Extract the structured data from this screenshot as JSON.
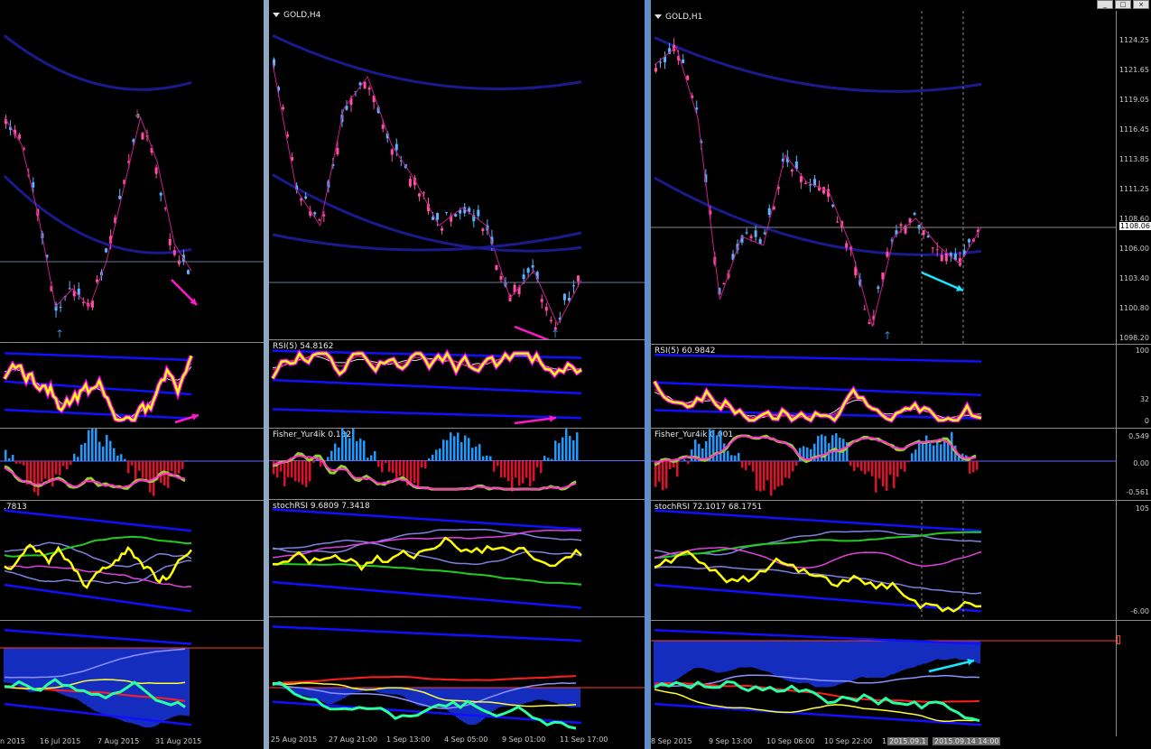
{
  "windows": [
    {
      "id": "left",
      "title": "",
      "rsi_label": "",
      "fisher_label": "",
      "stoch_label": ".7813",
      "x_labels": [
        "n 2015",
        "16 Jul 2015",
        "7 Aug 2015",
        "31 Aug 2015"
      ]
    },
    {
      "id": "middle",
      "title": "GOLD,H4",
      "rsi_label": "RSI(5) 54.8162",
      "fisher_label": "Fisher_Yur4ik 0.132",
      "stoch_label": "stochRSI 9.6809 7.3418",
      "x_labels": [
        "25 Aug 2015",
        "27 Aug 21:00",
        "1 Sep 13:00",
        "4 Sep 05:00",
        "9 Sep 01:00",
        "11 Sep 17:00"
      ]
    },
    {
      "id": "right",
      "title": "GOLD,H1",
      "rsi_label": "RSI(5) 60.9842",
      "fisher_label": "Fisher_Yur4ik 0.001",
      "stoch_label": "stochRSI 72.1017 68.1751",
      "x_labels": [
        "8 Sep 2015",
        "9 Sep 13:00",
        "10 Sep 06:00",
        "10 Sep 22:00",
        "1",
        "2015.09.1",
        "2015.09.14 14:00"
      ],
      "price_levels": [
        "1124.25",
        "1121.65",
        "1119.05",
        "1116.45",
        "1113.85",
        "1111.25",
        "1108.60",
        "1106.00",
        "1103.40",
        "1100.80",
        "1098.20"
      ],
      "current_price": "1108.06",
      "rsi_levels": [
        "100",
        "32",
        "0"
      ],
      "fisher_levels": [
        "0.549",
        "0.00",
        "-0.561"
      ],
      "stoch_levels": [
        "105",
        "-6.00"
      ]
    }
  ],
  "window_controls": {
    "minimize": "_",
    "restore": "□",
    "close": "×"
  },
  "colors": {
    "bull_candle": "#5ab4ff",
    "bear_candle": "#ff4fa3",
    "ma_band": "#1a1a8c",
    "rsi_main": "#ffff00",
    "rsi_shadow": "#ff00ff",
    "band_blue": "#1010ff",
    "hist_pos": "#1e9bff",
    "hist_neg": "#e0102a",
    "fisher_green": "#9acd32",
    "fisher_magenta": "#ff33cc",
    "stoch_green": "#22cc22",
    "arrow_magenta": "#ff19c8",
    "arrow_cyan": "#19e6ff",
    "fractal_up": "#3a7fd0",
    "fractal_down": "#a0522d"
  }
}
